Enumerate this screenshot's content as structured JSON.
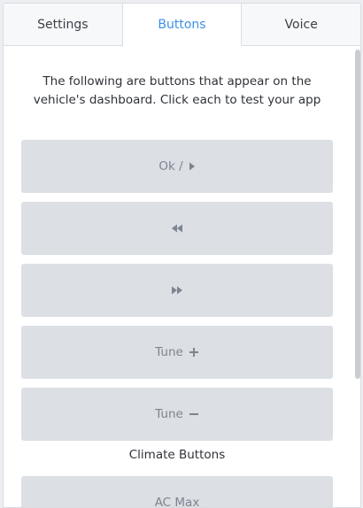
{
  "tabs": [
    {
      "label": "Settings",
      "active": false
    },
    {
      "label": "Buttons",
      "active": true
    },
    {
      "label": "Voice",
      "active": false
    }
  ],
  "intro_text": "The following are buttons that appear on the vehicle's dashboard. Click each to test your app",
  "buttons": {
    "ok": {
      "label": "Ok /",
      "icon": "play-icon"
    },
    "seek_left": {
      "label": "",
      "icon": "rewind-icon"
    },
    "seek_right": {
      "label": "",
      "icon": "fast-forward-icon"
    },
    "tune_up": {
      "label": "Tune",
      "icon": "plus-icon"
    },
    "tune_down": {
      "label": "Tune",
      "icon": "minus-icon"
    }
  },
  "climate_section": {
    "title": "Climate Buttons",
    "buttons": {
      "ac_max": {
        "label": "AC Max"
      }
    }
  },
  "colors": {
    "accent": "#3d8fe6",
    "button_bg": "#dcdfe3",
    "button_text": "#7d8491",
    "text": "#2e3138"
  }
}
